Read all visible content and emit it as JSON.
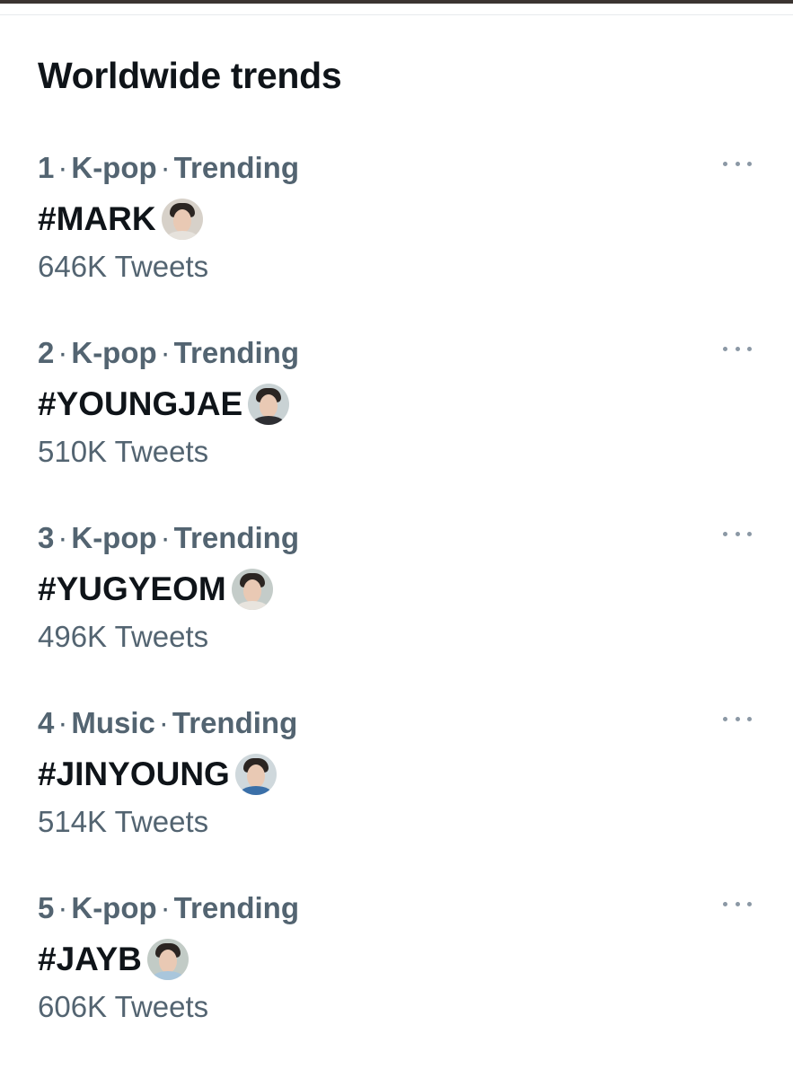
{
  "section": {
    "title": "Worldwide trends"
  },
  "trends": [
    {
      "rank": "1",
      "category": "K-pop",
      "status": "Trending",
      "hashtag": "#MARK",
      "tweets": "646K Tweets",
      "avatar_bg": "#d7d1c9",
      "shirt_color": "#e6e2dc"
    },
    {
      "rank": "2",
      "category": "K-pop",
      "status": "Trending",
      "hashtag": "#YOUNGJAE",
      "tweets": "510K Tweets",
      "avatar_bg": "#c9d2d4",
      "shirt_color": "#2e2f33"
    },
    {
      "rank": "3",
      "category": "K-pop",
      "status": "Trending",
      "hashtag": "#YUGYEOM",
      "tweets": "496K Tweets",
      "avatar_bg": "#c4ccc9",
      "shirt_color": "#e8e4de"
    },
    {
      "rank": "4",
      "category": "Music",
      "status": "Trending",
      "hashtag": "#JINYOUNG",
      "tweets": "514K Tweets",
      "avatar_bg": "#cfd8dc",
      "shirt_color": "#3a6fa8"
    },
    {
      "rank": "5",
      "category": "K-pop",
      "status": "Trending",
      "hashtag": "#JAYB",
      "tweets": "606K Tweets",
      "avatar_bg": "#c2cbc6",
      "shirt_color": "#a9c6dc"
    }
  ],
  "icons": {
    "more": "more-horizontal-icon",
    "avatar": "emoji-avatar-icon"
  },
  "colors": {
    "primary_text": "#0f1419",
    "secondary_text": "#536471",
    "more_icon": "#8b98a5",
    "divider": "#e7eaec",
    "link": "#1d9bf0"
  }
}
